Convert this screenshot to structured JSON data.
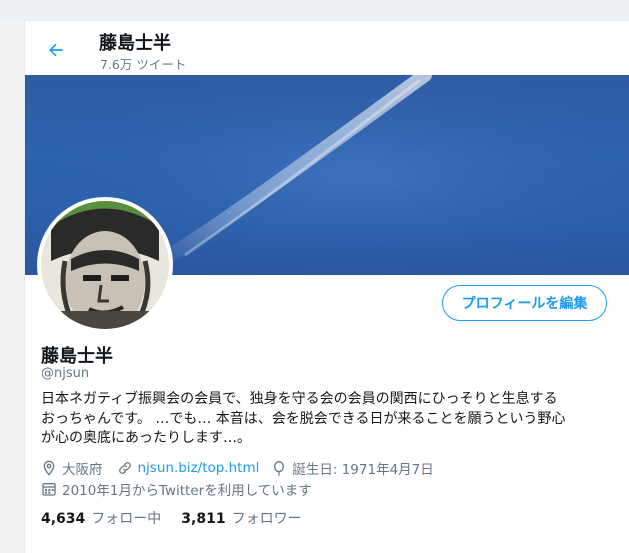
{
  "header": {
    "title": "藤島士半",
    "tweet_count": "7.6万 ツイート"
  },
  "profile": {
    "name": "藤島士半",
    "handle": "@njsun",
    "edit_label": "プロフィールを編集",
    "bio_lines": [
      "日本ネガティブ振興会の会員で、独身を守る会の会員の関西にひっそりと生息する",
      "おっちゃんです。 …でも… 本音は、会を脱会できる日が来ることを願うという野心",
      "が心の奥底にあったりします…。"
    ],
    "location": "大阪府",
    "url": "njsun.biz/top.html",
    "birthday": "誕生日: 1971年4月7日",
    "joined": "2010年1月からTwitterを利用しています"
  },
  "stats": {
    "following_count": "4,634",
    "following_label": "フォロー中",
    "followers_count": "3,811",
    "followers_label": "フォロワー"
  },
  "colors": {
    "accent": "#1d9bf0",
    "muted": "#657786",
    "banner_sky": "#2d63b0"
  },
  "icons": [
    "back-arrow-icon",
    "location-icon",
    "link-icon",
    "balloon-icon",
    "calendar-icon"
  ]
}
